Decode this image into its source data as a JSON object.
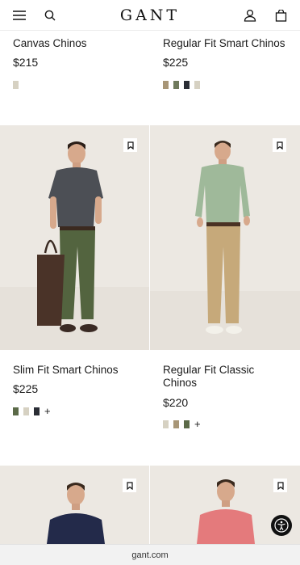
{
  "header": {
    "brand": "GANT",
    "menu_icon": "hamburger-menu-icon",
    "search_icon": "search-icon",
    "account_icon": "user-icon",
    "bag_icon": "shopping-bag-icon"
  },
  "products": [
    {
      "title": "Canvas Chinos",
      "price": "$215",
      "swatches": [
        "#d6d1c2"
      ],
      "more": ""
    },
    {
      "title": "Regular Fit Smart Chinos",
      "price": "$225",
      "swatches": [
        "#a89677",
        "#6f7a5c",
        "#2a2d35",
        "#d6d1c2"
      ],
      "more": ""
    },
    {
      "title": "Slim Fit Smart Chinos",
      "price": "$225",
      "swatches": [
        "#5b6a48",
        "#d6d1c2",
        "#2a2d35"
      ],
      "more": "+"
    },
    {
      "title": "Regular Fit Classic Chinos",
      "price": "$220",
      "swatches": [
        "#d6d1c2",
        "#a89677",
        "#5b6a48"
      ],
      "more": "+"
    }
  ],
  "colors": {
    "photo_bg": "#eeeae5",
    "olive_chino": "#53643f",
    "khaki_chino": "#c6a97a",
    "navy_sweater": "#232a4a",
    "pink_shirt": "#e47a7c",
    "green_shirt": "#9fb99a",
    "charcoal_tee": "#4c4f55"
  },
  "browser": {
    "url": "gant.com"
  },
  "accessibility_icon": "accessibility-icon"
}
